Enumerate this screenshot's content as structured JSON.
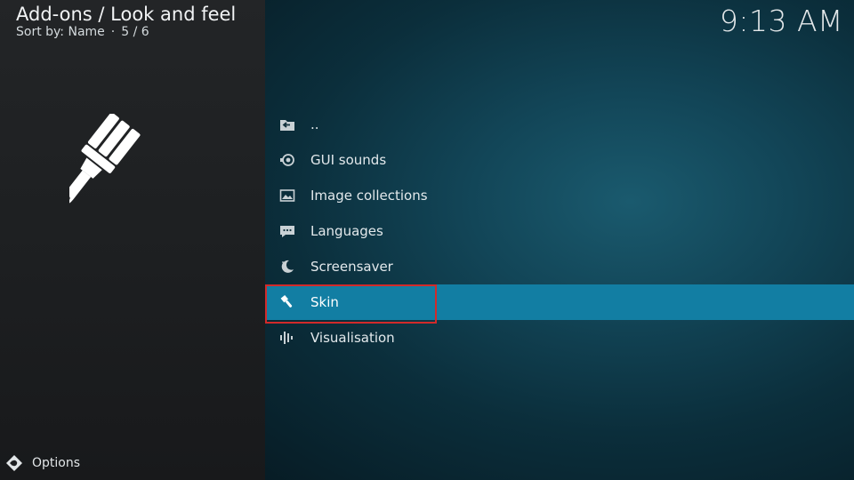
{
  "header": {
    "title": "Add-ons / Look and feel",
    "sort_label": "Sort by: Name",
    "separator": "·",
    "position": "5 / 6"
  },
  "clock": "9:13 AM",
  "hero_icon": "paintbrush-icon",
  "list": {
    "selected_index": 5,
    "items": [
      {
        "label": "..",
        "icon": "back-folder-icon"
      },
      {
        "label": "GUI sounds",
        "icon": "speaker-icon"
      },
      {
        "label": "Image collections",
        "icon": "image-icon"
      },
      {
        "label": "Languages",
        "icon": "speech-bubble-icon"
      },
      {
        "label": "Screensaver",
        "icon": "moon-icon"
      },
      {
        "label": "Skin",
        "icon": "paintbrush-icon"
      },
      {
        "label": "Visualisation",
        "icon": "equalizer-icon"
      }
    ]
  },
  "footer": {
    "options_label": "Options",
    "options_icon": "options-icon"
  },
  "colors": {
    "selection": "#127ea3",
    "highlight_border": "#d22a2a",
    "left_panel": "#1f2123"
  }
}
